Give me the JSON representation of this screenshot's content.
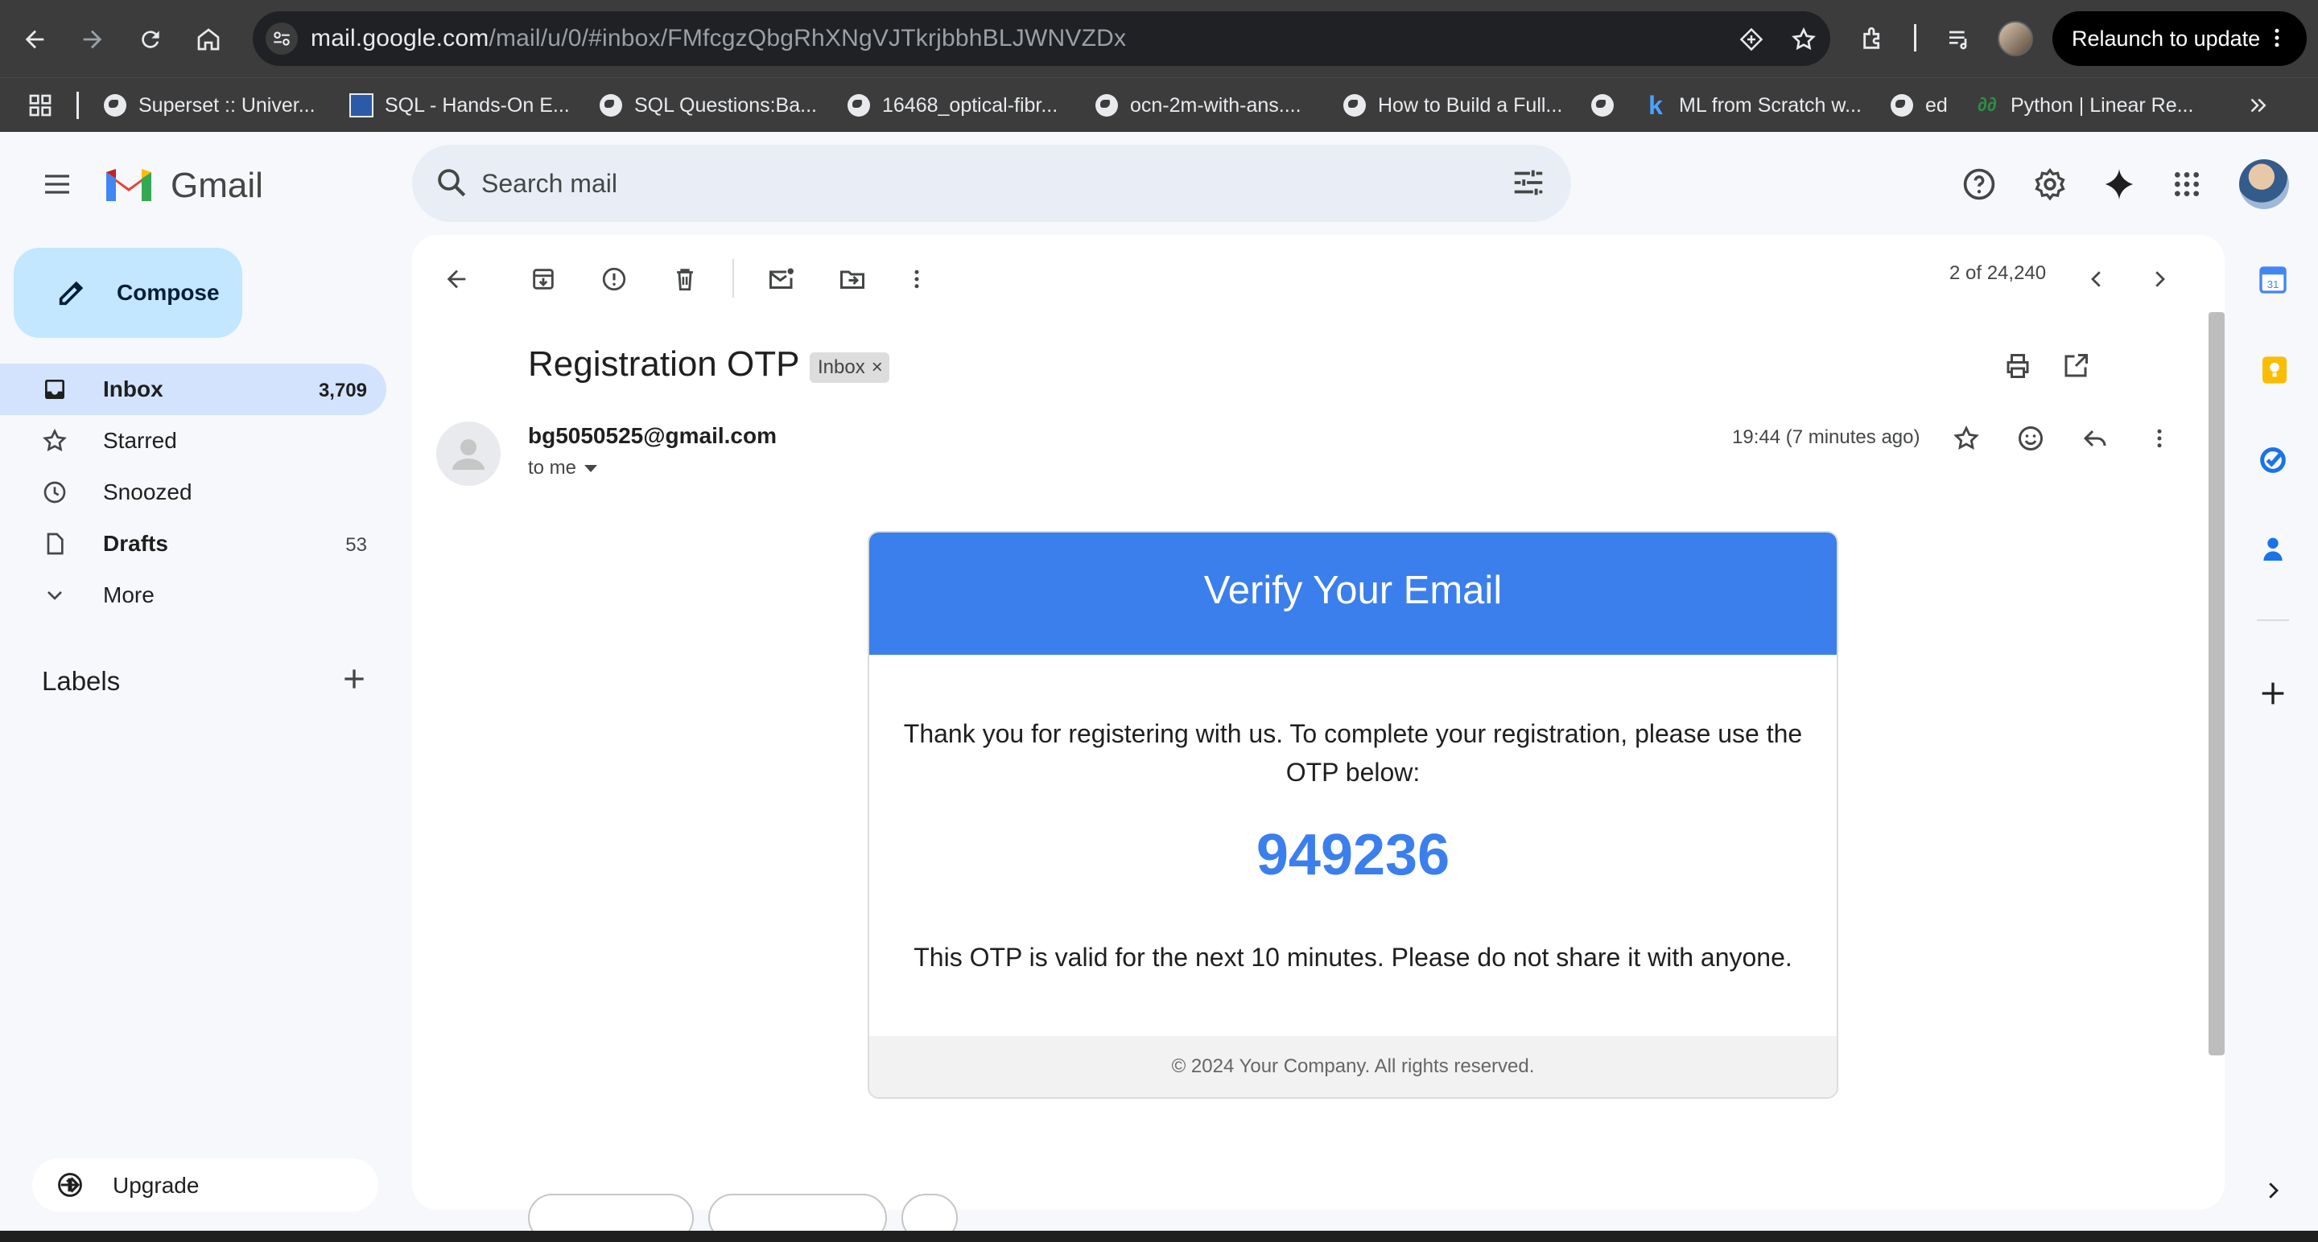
{
  "browser": {
    "url_host": "mail.google.com",
    "url_path": "/mail/u/0/#inbox/FMfcgzQbgRhXNgVJTkrjbbhBLJWNVZDx",
    "relaunch_label": "Relaunch to update",
    "bookmarks": [
      {
        "label": "Superset :: Univer...",
        "icon": "globe-icon"
      },
      {
        "label": "SQL - Hands-On E...",
        "icon": "site-icon"
      },
      {
        "label": "SQL Questions:Ba...",
        "icon": "globe-icon"
      },
      {
        "label": "16468_optical-fibr...",
        "icon": "globe-icon"
      },
      {
        "label": "ocn-2m-with-ans....",
        "icon": "globe-icon"
      },
      {
        "label": "How to Build a Full...",
        "icon": "globe-icon"
      },
      {
        "label": "",
        "icon": "globe-icon"
      },
      {
        "label": "ML from Scratch w...",
        "icon": "k-icon"
      },
      {
        "label": "ed",
        "icon": "globe-icon"
      },
      {
        "label": "Python | Linear Re...",
        "icon": "gfg-icon"
      }
    ]
  },
  "gmail": {
    "brand": "Gmail",
    "search_placeholder": "Search mail",
    "compose_label": "Compose",
    "nav": [
      {
        "label": "Inbox",
        "count": "3,709",
        "icon": "inbox-icon"
      },
      {
        "label": "Starred",
        "count": "",
        "icon": "star-icon"
      },
      {
        "label": "Snoozed",
        "count": "",
        "icon": "clock-icon"
      },
      {
        "label": "Drafts",
        "count": "53",
        "icon": "draft-icon"
      },
      {
        "label": "More",
        "count": "",
        "icon": "chevron-down-icon"
      }
    ],
    "labels_title": "Labels",
    "upgrade_label": "Upgrade"
  },
  "message": {
    "pager": "2 of 24,240",
    "subject": "Registration OTP",
    "label_chip": "Inbox",
    "label_chip_close": "×",
    "sender": "bg5050525@gmail.com",
    "recipient": "to me",
    "timestamp": "19:44 (7 minutes ago)"
  },
  "email_card": {
    "heading": "Verify Your Email",
    "intro": "Thank you for registering with us. To complete your registration, please use the OTP below:",
    "otp": "949236",
    "validity": "This OTP is valid for the next 10 minutes. Please do not share it with anyone.",
    "footer": "© 2024 Your Company. All rights reserved."
  },
  "colors": {
    "accent": "#3b7fec",
    "compose_bg": "#c2e7ff",
    "active_nav": "#d3e3fd"
  }
}
